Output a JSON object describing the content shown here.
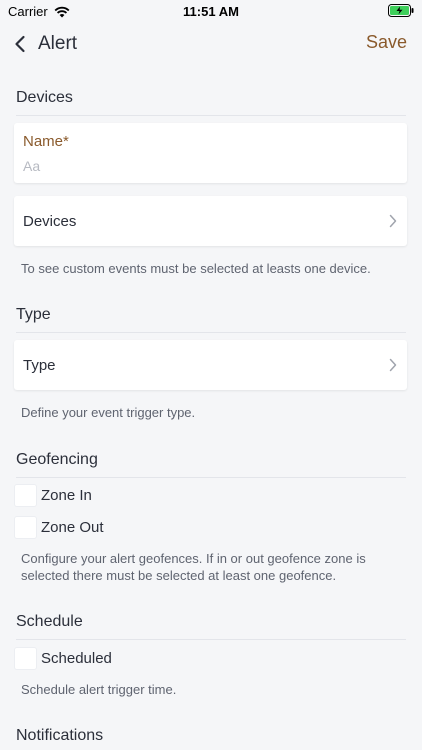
{
  "status_bar": {
    "carrier": "Carrier",
    "time": "11:51 AM"
  },
  "nav": {
    "title": "Alert",
    "save_label": "Save"
  },
  "colors": {
    "accent": "#8a5a2c",
    "background": "#f5f6f8",
    "text": "#2b2f3a",
    "hint": "#5f6470"
  },
  "devices_section": {
    "title": "Devices",
    "name_label": "Name*",
    "name_placeholder": "Aa",
    "name_value": "",
    "devices_row_label": "Devices",
    "hint": "To see custom events must be selected at leasts one device."
  },
  "type_section": {
    "title": "Type",
    "type_row_label": "Type",
    "hint": "Define your event trigger type."
  },
  "geofencing_section": {
    "title": "Geofencing",
    "zone_in_label": "Zone In",
    "zone_in_checked": false,
    "zone_out_label": "Zone Out",
    "zone_out_checked": false,
    "hint": "Configure your alert geofences. If in or out geofence zone is selected there must be selected at least one geofence."
  },
  "schedule_section": {
    "title": "Schedule",
    "scheduled_label": "Scheduled",
    "scheduled_checked": false,
    "hint": "Schedule alert trigger time."
  },
  "notifications_section": {
    "title": "Notifications"
  }
}
